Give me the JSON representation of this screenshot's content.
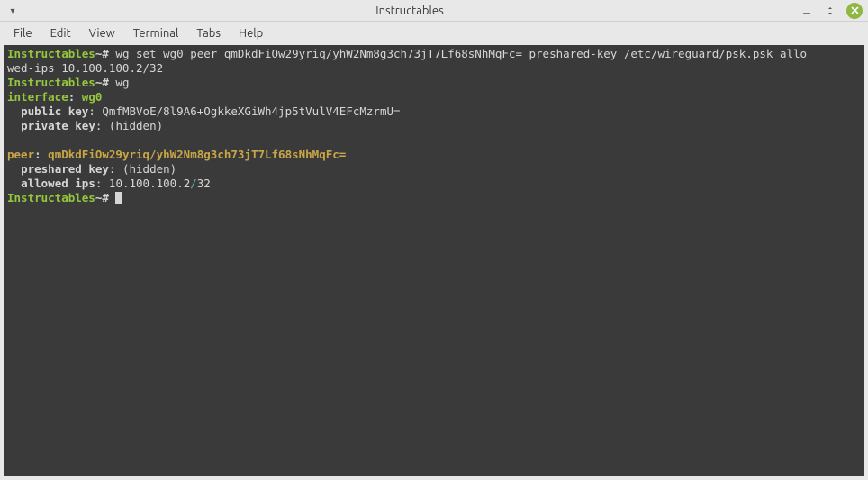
{
  "window": {
    "title": "Instructables"
  },
  "menubar": {
    "items": [
      "File",
      "Edit",
      "View",
      "Terminal",
      "Tabs",
      "Help"
    ]
  },
  "terminal": {
    "prompt_host": "Instructables",
    "prompt_sep1": "~#",
    "cmd1": " wg set wg0 peer qmDkdFiOw29yriq/yhW2Nm8g3ch73jT7Lf68sNhMqFc= preshared-key /etc/wireguard/psk.psk allo",
    "cmd1_wrap": "wed-ips 10.100.100.2/32",
    "cmd2": " wg",
    "iface_label": "interface",
    "iface_name": "wg0",
    "pubkey_label": "public key",
    "pubkey_val": "QmfMBVoE/8l9A6+OgkkeXGiWh4jp5tVulV4EFcMzrmU=",
    "privkey_label": "private key",
    "privkey_val": "(hidden)",
    "peer_label": "peer",
    "peer_val": "qmDkdFiOw29yriq/yhW2Nm8g3ch73jT7Lf68sNhMqFc=",
    "psk_label": "preshared key",
    "psk_val": "(hidden)",
    "allowed_label": "allowed ips",
    "allowed_ip": "10.100.100.2",
    "allowed_slash": "/",
    "allowed_mask": "32"
  }
}
